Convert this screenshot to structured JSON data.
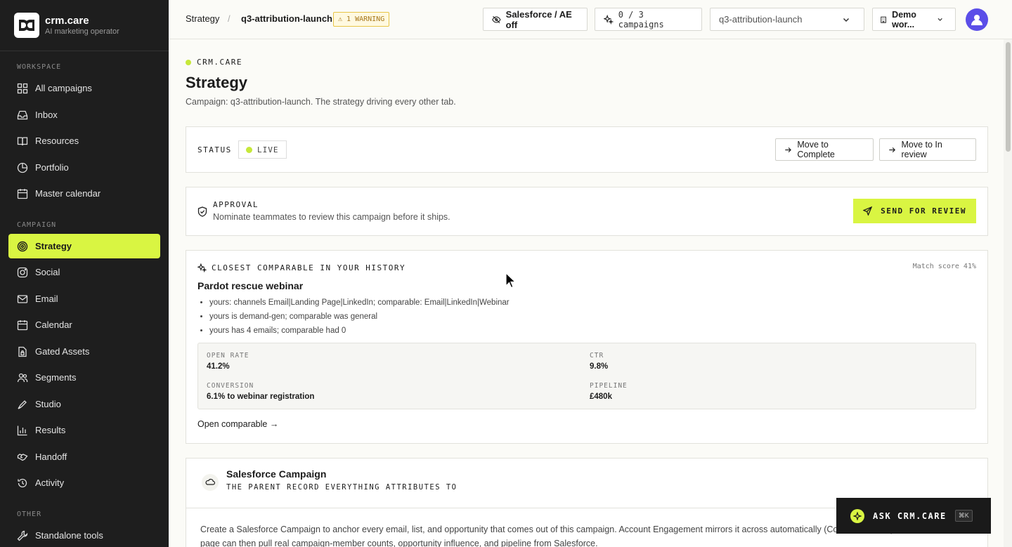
{
  "brand": {
    "name": "crm.care",
    "subtitle": "AI marketing operator"
  },
  "sidebar": {
    "workspace_label": "WORKSPACE",
    "workspace_items": [
      {
        "label": "All campaigns",
        "icon": "grid-icon"
      },
      {
        "label": "Inbox",
        "icon": "inbox-icon"
      },
      {
        "label": "Resources",
        "icon": "book-icon"
      },
      {
        "label": "Portfolio",
        "icon": "pie-chart-icon"
      },
      {
        "label": "Master calendar",
        "icon": "calendar-icon"
      }
    ],
    "campaign_label": "CAMPAIGN",
    "campaign_items": [
      {
        "label": "Strategy",
        "icon": "target-icon",
        "active": true
      },
      {
        "label": "Social",
        "icon": "instagram-icon"
      },
      {
        "label": "Email",
        "icon": "mail-icon"
      },
      {
        "label": "Calendar",
        "icon": "calendar-icon"
      },
      {
        "label": "Gated Assets",
        "icon": "file-lock-icon"
      },
      {
        "label": "Segments",
        "icon": "users-icon"
      },
      {
        "label": "Studio",
        "icon": "pen-tool-icon"
      },
      {
        "label": "Results",
        "icon": "bar-chart-icon"
      },
      {
        "label": "Handoff",
        "icon": "handshake-icon"
      },
      {
        "label": "Activity",
        "icon": "history-icon"
      }
    ],
    "other_label": "OTHER",
    "other_items": [
      {
        "label": "Standalone tools",
        "icon": "wrench-icon"
      }
    ]
  },
  "header": {
    "breadcrumb_root": "Strategy",
    "breadcrumb_sep": "/",
    "breadcrumb_current": "q3-attribution-launch",
    "warning_badge": "⚠ 1 WARNING",
    "salesforce_toggle": "Salesforce / AE off",
    "campaigns_counter": "0 / 3 campaigns",
    "campaign_select_value": "q3-attribution-launch",
    "workspace_select_value": "Demo wor..."
  },
  "page": {
    "eyebrow": "CRM.CARE",
    "title": "Strategy",
    "subtitle": "Campaign: q3-attribution-launch. The strategy driving every other tab."
  },
  "status_card": {
    "label": "STATUS",
    "status_value": "LIVE",
    "move_complete_label": "Move to Complete",
    "move_review_label": "Move to In review"
  },
  "approval_card": {
    "label": "APPROVAL",
    "description": "Nominate teammates to review this campaign before it ships.",
    "send_label": "SEND FOR REVIEW"
  },
  "comparable_card": {
    "label": "CLOSEST COMPARABLE IN YOUR HISTORY",
    "match_score": "Match score 41%",
    "name": "Pardot rescue webinar",
    "reasons": [
      "yours: channels Email|Landing Page|LinkedIn; comparable: Email|LinkedIn|Webinar",
      "yours is demand-gen; comparable was general",
      "yours has 4 emails; comparable had 0"
    ],
    "metrics": {
      "open_rate_label": "OPEN RATE",
      "open_rate": "41.2%",
      "ctr_label": "CTR",
      "ctr": "9.8%",
      "conversion_label": "CONVERSION",
      "conversion": "6.1% to webinar registration",
      "pipeline_label": "PIPELINE",
      "pipeline": "£480k"
    },
    "open_link": "Open comparable →"
  },
  "salesforce_card": {
    "title": "Salesforce Campaign",
    "subtitle": "THE PARENT RECORD EVERYTHING ATTRIBUTES TO",
    "body_line1": "Create a Salesforce Campaign to anchor every email, list, and opportunity that comes out of this campaign. Account Engagement mirrors it across automatically (Connected Campaigns),",
    "body_line2": "page can then pull real campaign-member counts, opportunity influence, and pipeline from Salesforce."
  },
  "assistant": {
    "label": "ASK CRM.CARE",
    "shortcut": "⌘K"
  },
  "colors": {
    "accent": "#d9f542",
    "sidebar_bg": "#1e1e1e",
    "warning": "#e8c547",
    "avatar": "#5b4ee8"
  }
}
